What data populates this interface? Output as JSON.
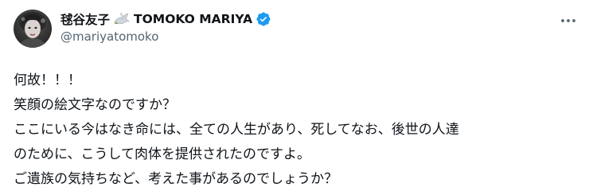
{
  "author": {
    "display_name": "毬谷友子",
    "name_latin": "TOMOKO MARIYA",
    "handle": "@mariyatomoko",
    "avatar_icon": "profile-photo",
    "verified_icon": "verified-badge-icon",
    "verified_color": "#1d9bf0",
    "dove_icon": "dove-emoji-icon"
  },
  "actions": {
    "more_icon": "more-horizontal-icon"
  },
  "tweet": {
    "lines": [
      "何故！！！",
      "笑顔の絵文字なのですか？",
      "ここにいる今はなき命には、全ての人生があり、死してなお、後世の人達",
      "のために、こうして肉体を提供されたのですよ。",
      "ご遺族の気持ちなど、考えた事があるのでしょうか？"
    ]
  },
  "colors": {
    "text_primary": "#0f1419",
    "text_secondary": "#536471",
    "background": "#ffffff"
  }
}
